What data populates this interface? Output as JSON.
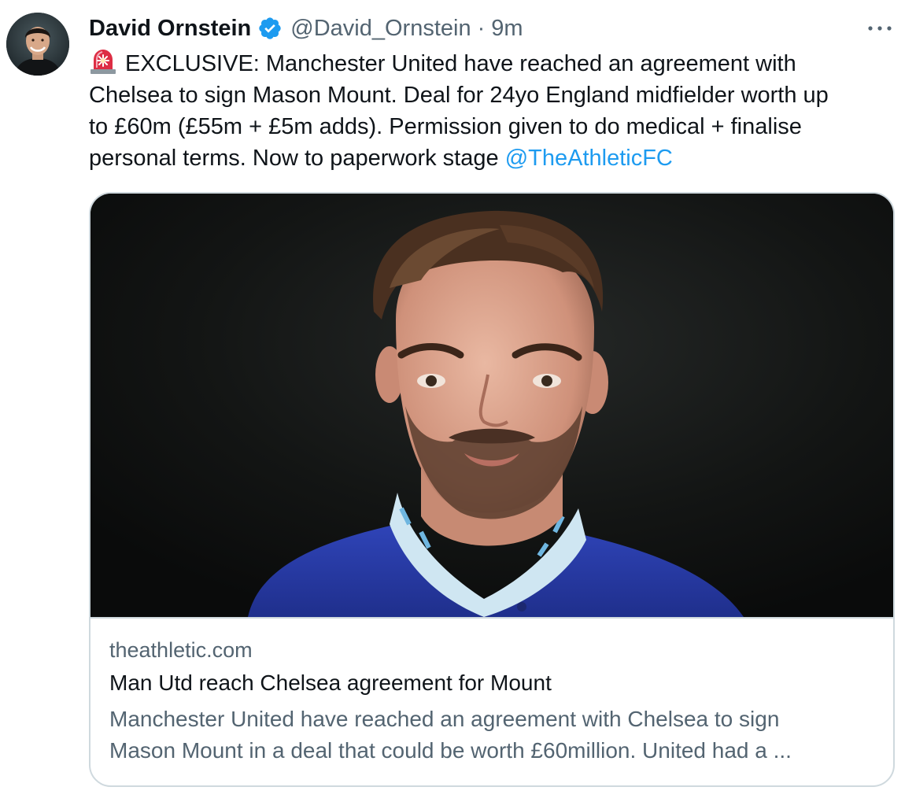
{
  "author": {
    "display_name": "David Ornstein",
    "handle": "@David_Ornstein",
    "separator": "·",
    "time": "9m",
    "avatar_icon": "profile-photo",
    "verified_icon": "verified-badge-icon"
  },
  "more_icon": "more-horizontal-icon",
  "tweet": {
    "emoji_icon": "police-light-icon",
    "lines": [
      "EXCLUSIVE: Manchester United have reached an agreement with",
      "Chelsea to sign Mason Mount. Deal for 24yo England midfielder worth up",
      "to £60m (£55m + £5m adds). Permission given to do medical + finalise",
      "personal terms. Now to paperwork stage "
    ],
    "mention": "@TheAthleticFC"
  },
  "card": {
    "image_icon": "player-photo",
    "domain": "theathletic.com",
    "title": "Man Utd reach Chelsea agreement for Mount",
    "description_lines": [
      "Manchester United have reached an agreement with Chelsea to sign",
      "Mason Mount in a deal that could be worth £60million. United had a ..."
    ]
  },
  "colors": {
    "link": "#1d9bf0",
    "secondary_text": "#536471",
    "primary_text": "#0f1419",
    "border": "#cfd9de",
    "verified": "#1d9bf0"
  }
}
